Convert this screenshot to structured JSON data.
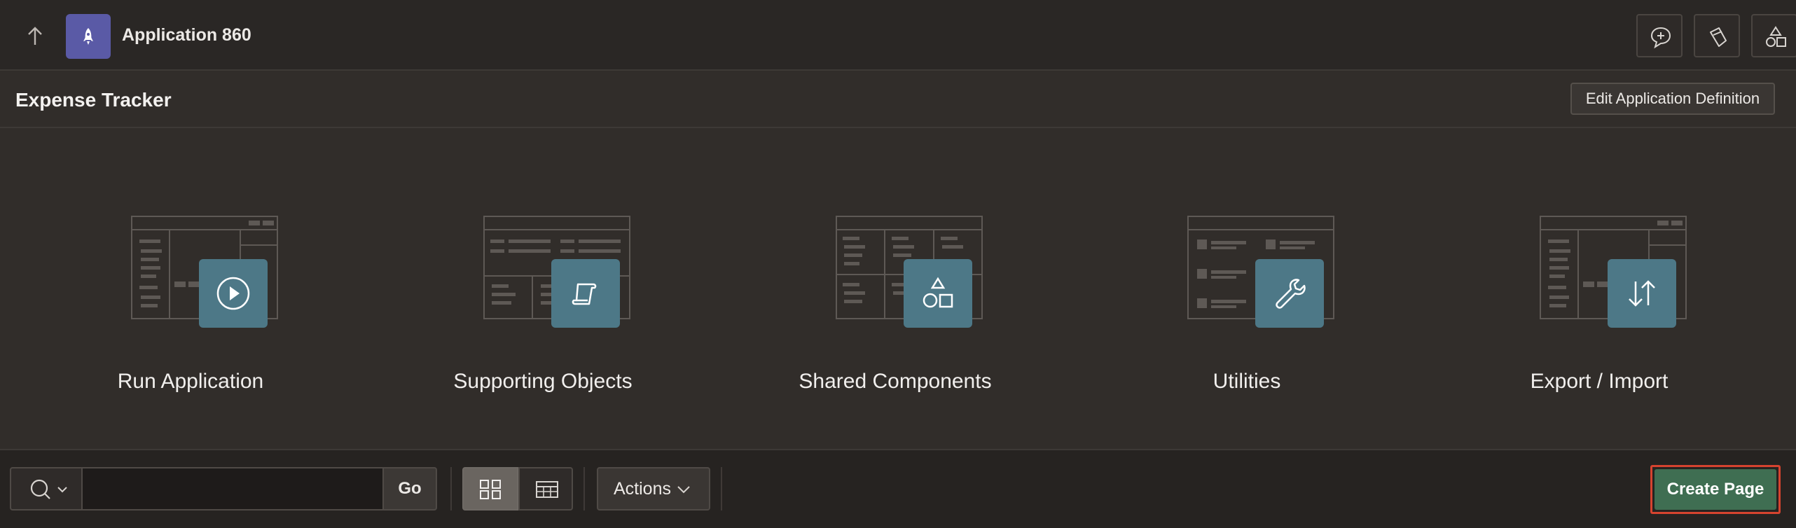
{
  "topbar": {
    "app_title": "Application 860",
    "icons": [
      "arrow-up-icon",
      "rocket-icon",
      "comment-add-icon",
      "bucket-icon",
      "shapes-icon"
    ]
  },
  "header": {
    "page_title": "Expense Tracker",
    "edit_button_label": "Edit Application Definition"
  },
  "tiles": [
    {
      "label": "Run Application",
      "icon": "play-icon"
    },
    {
      "label": "Supporting Objects",
      "icon": "scroll-icon"
    },
    {
      "label": "Shared Components",
      "icon": "shapes-icon"
    },
    {
      "label": "Utilities",
      "icon": "wrench-icon"
    },
    {
      "label": "Export / Import",
      "icon": "arrows-up-down-icon"
    }
  ],
  "toolbar": {
    "search_value": "",
    "go_label": "Go",
    "actions_label": "Actions",
    "create_label": "Create Page",
    "active_view": "icons"
  },
  "colors": {
    "background": "#312d2a",
    "badge": "#4d7887",
    "create_button": "#3f6e52",
    "highlight_border": "#d6432f",
    "app_icon": "#5a5aa6"
  }
}
